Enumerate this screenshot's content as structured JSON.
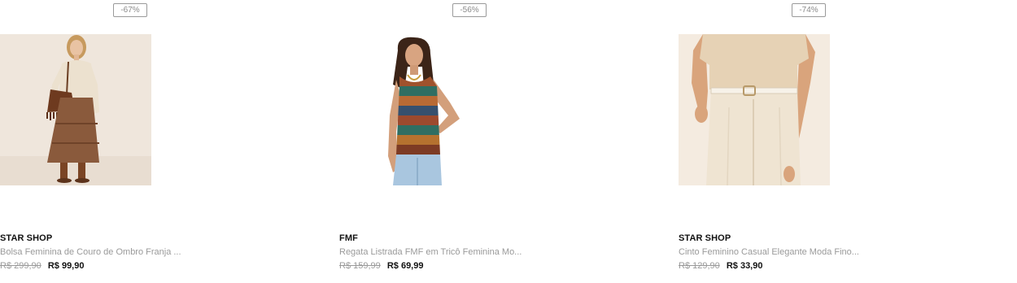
{
  "products": [
    {
      "discount": "-67%",
      "brand": "STAR SHOP",
      "title": "Bolsa Feminina de Couro de Ombro Franja ...",
      "old_price": "R$ 299,90",
      "price": "R$ 99,90"
    },
    {
      "discount": "-56%",
      "brand": "FMF",
      "title": "Regata Listrada FMF em Tricô Feminina Mo...",
      "old_price": "R$ 159,99",
      "price": "R$ 69,99"
    },
    {
      "discount": "-74%",
      "brand": "STAR SHOP",
      "title": "Cinto Feminino Casual Elegante Moda Fino...",
      "old_price": "R$ 129,90",
      "price": "R$ 33,90"
    }
  ]
}
